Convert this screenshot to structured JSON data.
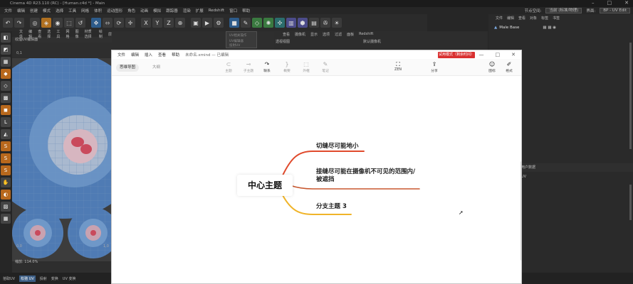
{
  "c4d": {
    "title": "Cinema 4D R23.110 (RC) - [Human.c4d *] - Main",
    "menu": [
      "文件",
      "编辑",
      "创建",
      "模式",
      "选择",
      "工具",
      "网格",
      "体积",
      "运动图形",
      "角色",
      "动画",
      "模拟",
      "跟踪器",
      "渲染",
      "扩展",
      "Redshift",
      "窗口",
      "帮助"
    ],
    "node_space_label": "节点空间:",
    "node_space_value": "当前 (标准/物理)",
    "layout_label": "界面:",
    "layout_value": "BP - UV Edit",
    "uv_menu": [
      "文件",
      "编辑",
      "查看",
      "选择",
      "工具",
      "网格",
      "图像",
      "材质选择",
      "绘制",
      "层"
    ],
    "uv_title": "纹理UV编辑器",
    "uv_zoom": "缩放: 114.0%",
    "uv_ruler_top": "0,1",
    "uv_ruler_bottom": "0,0",
    "uv_ruler_right": "1,0",
    "viewport_menu": [
      "查看",
      "摄像机",
      "显示",
      "选项",
      "过滤",
      "面板",
      "Redshift"
    ],
    "viewport_title": "透视视图",
    "viewport_camera": "默认摄像机",
    "dropdown_items": [
      "UV相关操作",
      "UV编辑器",
      "投射UV"
    ],
    "obj_header": [
      "文件",
      "编辑",
      "查看",
      "对象",
      "标签",
      "书签"
    ],
    "obj_item": "Male Base",
    "obj_mid_header": "用户数据",
    "obj_mid_tabs": [
      "模式",
      "编辑",
      "用户数据"
    ],
    "obj_mid_left": "UV",
    "bottom_tabs": [
      "拾取UV",
      "松弛 UV",
      "投射",
      "变换",
      "UV 变换"
    ],
    "bottom_active": "松弛 UV"
  },
  "xmind": {
    "menu": [
      "文件",
      "编辑",
      "插入",
      "查看",
      "帮助"
    ],
    "doc_title": "未命名.xmind — 已编辑",
    "trial": "试用模式（剩余时间）",
    "win": [
      "—",
      "□",
      "✕"
    ],
    "view_tabs": [
      "思维导图",
      "大纲"
    ],
    "toolbar": [
      {
        "label": "主题",
        "icon": "⊂"
      },
      {
        "label": "子主题",
        "icon": "⊸"
      },
      {
        "label": "联系",
        "icon": "↷"
      },
      {
        "label": "概要",
        "icon": "}"
      },
      {
        "label": "外框",
        "icon": "⬚"
      },
      {
        "label": "笔记",
        "icon": "✎"
      },
      {
        "label": "ZEN",
        "icon": "⛶"
      },
      {
        "label": "分享",
        "icon": "⇪"
      },
      {
        "label": "图标",
        "icon": "☺"
      },
      {
        "label": "格式",
        "icon": "✐"
      }
    ],
    "central_topic": "中心主题",
    "topics": [
      "切缝尽可能地小",
      "接缝尽可能在摄像机不可见的范围内/",
      "被遮挡",
      "分支主题 3"
    ],
    "colors": {
      "branch1": "#e04a2c",
      "branch2": "#c8572e",
      "branch3": "#f0b429"
    }
  }
}
